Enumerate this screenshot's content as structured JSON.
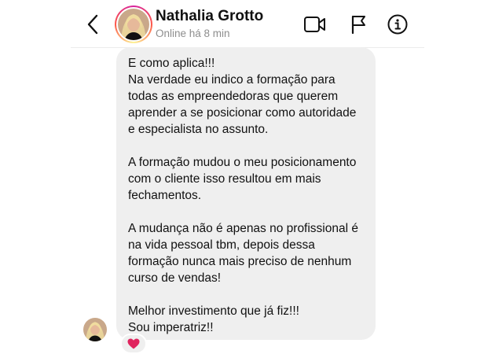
{
  "header": {
    "contact_name": "Nathalia Grotto",
    "status": "Online há 8 min",
    "icons": {
      "back": "chevron-left-icon",
      "video": "video-camera-icon",
      "flag": "flag-icon",
      "info": "info-icon"
    }
  },
  "message": {
    "paragraphs": [
      "E como aplica!!!\nNa verdade eu indico a formação para todas as empreendedoras que querem aprender a se posicionar como autoridade e especialista no assunto.",
      "A formação mudou o meu posicionamento com o cliente isso resultou em mais fechamentos.",
      "A mudança não é apenas no profissional é na vida pessoal tbm, depois dessa formação nunca mais preciso de nenhum curso de vendas!",
      "Melhor investimento que já fiz!!!\nSou imperatriz!!"
    ],
    "reaction": "❤️"
  },
  "colors": {
    "bubble_bg": "#efefef",
    "secondary_text": "#8e8e8e",
    "reaction_heart": "#e0245e"
  }
}
